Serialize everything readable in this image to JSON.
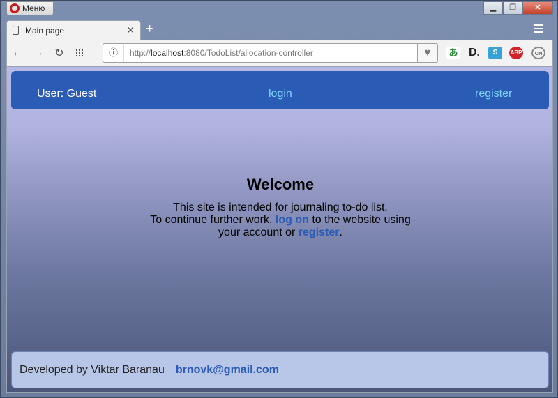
{
  "browser": {
    "menu_label": "Меню",
    "tab_title": "Main page",
    "url_prefix": "http://",
    "url_host": "localhost",
    "url_rest": ":8080/TodoList/allocation-controller"
  },
  "header": {
    "user_label": "User: Guest",
    "login_label": "login",
    "register_label": "register"
  },
  "main": {
    "title": "Welcome",
    "line1": "This site is intended for journaling to-do list.",
    "line2_pre": "To continue further work, ",
    "log_on_link": "log on",
    "line2_post": " to the website using",
    "line3_pre": "your account or ",
    "register_link": "register",
    "line3_post": "."
  },
  "footer": {
    "developer_text": "Developed by Viktar Baranau",
    "email": "brnovk@gmail.com"
  },
  "colors": {
    "header_bg": "#2a5cb5",
    "link_header": "#7fd6ff",
    "link_body": "#2a5cb5",
    "footer_bg": "#b8c6e8"
  },
  "icons": [
    "opera-logo-icon",
    "document-icon",
    "close-tab-icon",
    "new-tab-icon",
    "back-icon",
    "forward-icon",
    "reload-icon",
    "speed-dial-icon",
    "site-info-icon",
    "bookmark-heart-icon",
    "translate-icon",
    "d-extension-icon",
    "s-extension-icon",
    "adblock-icon",
    "on-extension-icon"
  ]
}
